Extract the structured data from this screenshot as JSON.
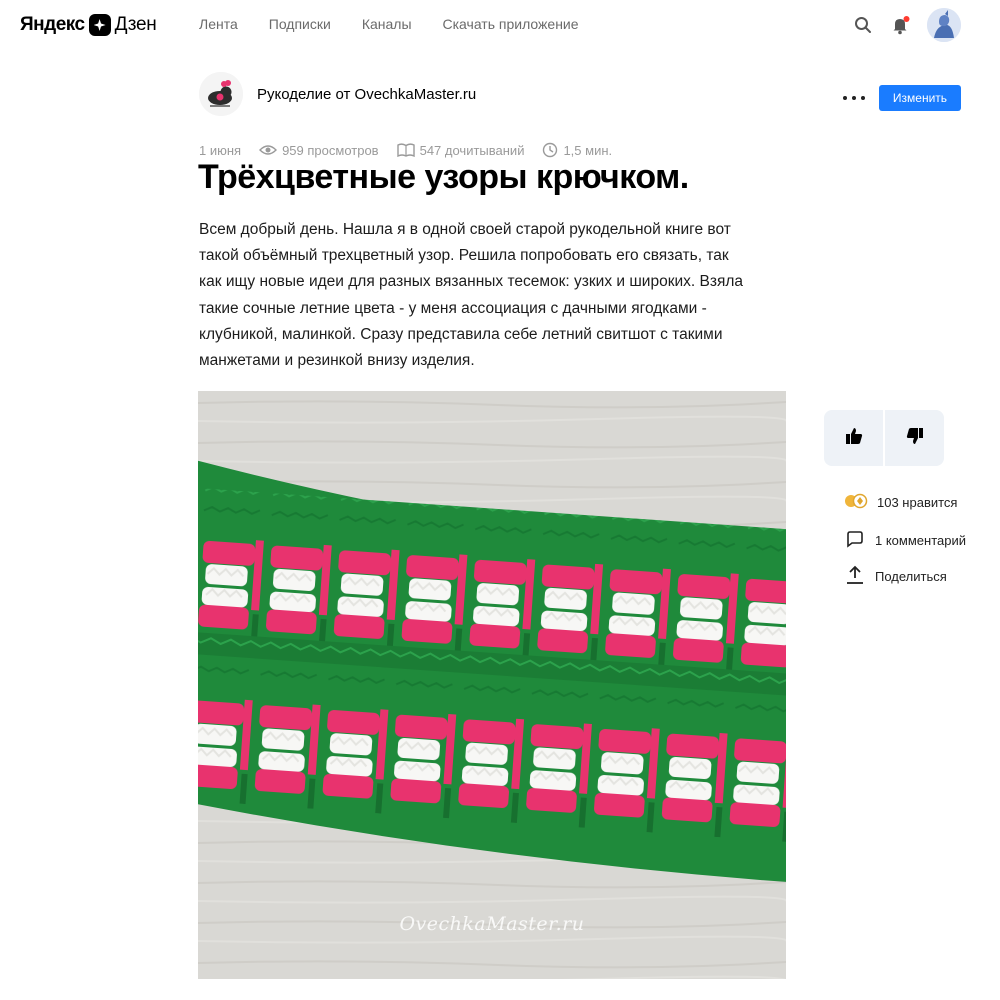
{
  "header": {
    "logo_left": "Яндекс",
    "logo_right": "Дзен",
    "nav": [
      "Лента",
      "Подписки",
      "Каналы",
      "Скачать приложение"
    ],
    "icons": [
      "search-icon",
      "bell-icon",
      "avatar"
    ],
    "notification_dot_color": "#ff3b30"
  },
  "channel": {
    "name": "Рукоделие от OvechkaMaster.ru",
    "edit_label": "Изменить",
    "edit_color": "#1a7cff"
  },
  "meta": {
    "date": "1 июня",
    "views": "959 просмотров",
    "reads": "547 дочитываний",
    "time": "1,5 мин."
  },
  "article": {
    "title": "Трёхцветные узоры крючком.",
    "lines": [
      "Всем добрый день. Нашла я в одной своей старой рукодельной книге вот",
      "такой объёмный трехцветный узор. Решила попробовать его связать, так",
      "как ищу новые идеи для разных вязанных тесемок: узких и широких. Взяла",
      "такие сочные летние цвета - у меня ассоциация с дачными ягодками -",
      "клубникой, малинкой. Сразу представила себе летний свитшот с такими",
      "манжетами и резинкой внизу изделия."
    ],
    "photo_watermark": "OvechkaMaster.ru",
    "photo_colors": {
      "green": "#1f8a3b",
      "pink": "#e8336e",
      "white": "#f7f7f5",
      "board": "#d9d8d4"
    }
  },
  "sidebar": {
    "likes": "103 нравится",
    "comments": "1 комментарий",
    "share": "Поделиться"
  }
}
